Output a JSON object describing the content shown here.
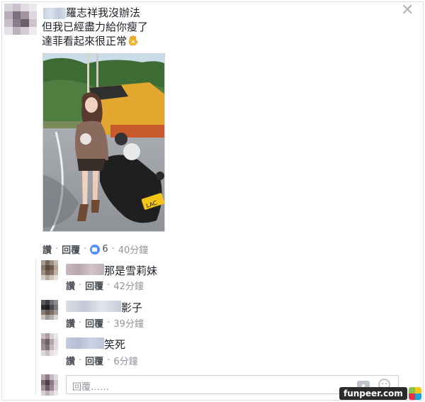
{
  "post": {
    "line1": "羅志祥我沒辦法",
    "line2": "但我已經盡力給你瘦了",
    "line3": "達菲看起來很正常",
    "emoji_icon": "ok-hand-emoji",
    "actions": {
      "like_label": "讚",
      "reply_label": "回覆",
      "like_count": "6",
      "time": "40分鐘"
    }
  },
  "comments": [
    {
      "text": "那是雪莉妹",
      "like_label": "讚",
      "reply_label": "回覆",
      "time": "42分鐘"
    },
    {
      "text": "影子",
      "like_label": "讚",
      "reply_label": "回覆",
      "time": "39分鐘"
    },
    {
      "text": "笑死",
      "like_label": "讚",
      "reply_label": "回覆",
      "time": "6分鐘"
    }
  ],
  "reply_box": {
    "placeholder": "回覆……"
  },
  "watermark": {
    "text": "funpeer.com"
  },
  "colors": {
    "link": "#4b4f56",
    "meta": "#90949c",
    "like_blue": "#5890ff",
    "border": "#dddfe2"
  }
}
